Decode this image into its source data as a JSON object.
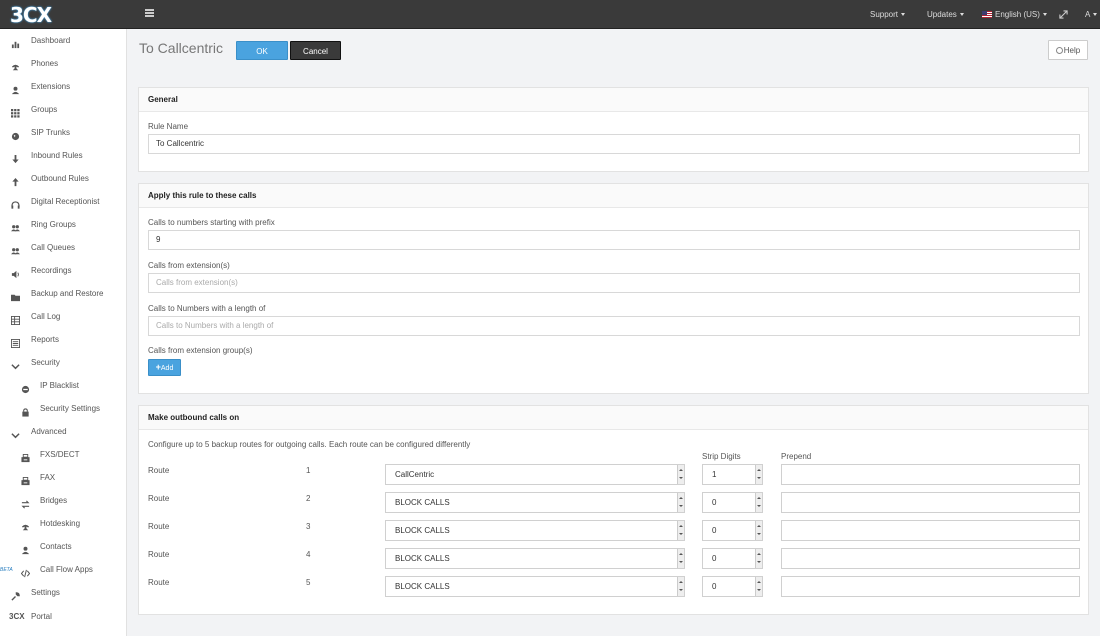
{
  "topbar": {
    "logo": "3CX",
    "support": "Support",
    "updates": "Updates",
    "language": "English (US)",
    "user": "A"
  },
  "sidebar": {
    "items": [
      {
        "label": "Dashboard",
        "icon": "bar-chart-icon"
      },
      {
        "label": "Phones",
        "icon": "phone-icon"
      },
      {
        "label": "Extensions",
        "icon": "user-icon"
      },
      {
        "label": "Groups",
        "icon": "grid-icon"
      },
      {
        "label": "SIP Trunks",
        "icon": "globe-icon"
      },
      {
        "label": "Inbound Rules",
        "icon": "arrow-down-icon"
      },
      {
        "label": "Outbound Rules",
        "icon": "arrow-up-icon"
      },
      {
        "label": "Digital Receptionist",
        "icon": "headset-icon"
      },
      {
        "label": "Ring Groups",
        "icon": "users-icon"
      },
      {
        "label": "Call Queues",
        "icon": "users-icon"
      },
      {
        "label": "Recordings",
        "icon": "speaker-icon"
      },
      {
        "label": "Backup and Restore",
        "icon": "folder-icon"
      },
      {
        "label": "Call Log",
        "icon": "table-icon"
      },
      {
        "label": "Reports",
        "icon": "list-icon"
      },
      {
        "label": "Security",
        "icon": "chevron-down-icon"
      },
      {
        "label": "IP Blacklist",
        "icon": "minus-circle-icon"
      },
      {
        "label": "Security Settings",
        "icon": "lock-icon"
      },
      {
        "label": "Advanced",
        "icon": "chevron-down-icon"
      },
      {
        "label": "FXS/DECT",
        "icon": "fax-icon"
      },
      {
        "label": "FAX",
        "icon": "fax-icon"
      },
      {
        "label": "Bridges",
        "icon": "exchange-icon"
      },
      {
        "label": "Hotdesking",
        "icon": "phone-icon"
      },
      {
        "label": "Contacts",
        "icon": "user-icon"
      },
      {
        "label": "Call Flow Apps",
        "icon": "code-icon",
        "badge": "BETA"
      },
      {
        "label": "Settings",
        "icon": "wrench-icon"
      },
      {
        "label": "Portal",
        "icon": "3cx-logo-icon",
        "icon_text": "3CX"
      }
    ]
  },
  "header": {
    "title": "To Callcentric",
    "ok": "OK",
    "cancel": "Cancel",
    "help": "Help"
  },
  "general": {
    "heading": "General",
    "rule_name_label": "Rule Name",
    "rule_name_value": "To Callcentric"
  },
  "apply": {
    "heading": "Apply this rule to these calls",
    "prefix_label": "Calls to numbers starting with prefix",
    "prefix_value": "9",
    "from_ext_label": "Calls from extension(s)",
    "from_ext_placeholder": "Calls from extension(s)",
    "length_label": "Calls to Numbers with a length of",
    "length_placeholder": "Calls to Numbers with a length of",
    "group_label": "Calls from extension group(s)",
    "add_label": "Add"
  },
  "outbound": {
    "heading": "Make outbound calls on",
    "description": "Configure up to 5 backup routes for outgoing calls. Each route can be configured differently",
    "strip_digits_header": "Strip Digits",
    "prepend_header": "Prepend",
    "routes": [
      {
        "label": "Route",
        "number": "1",
        "gateway": "CallCentric",
        "strip": "1",
        "prepend": ""
      },
      {
        "label": "Route",
        "number": "2",
        "gateway": "BLOCK CALLS",
        "strip": "0",
        "prepend": ""
      },
      {
        "label": "Route",
        "number": "3",
        "gateway": "BLOCK CALLS",
        "strip": "0",
        "prepend": ""
      },
      {
        "label": "Route",
        "number": "4",
        "gateway": "BLOCK CALLS",
        "strip": "0",
        "prepend": ""
      },
      {
        "label": "Route",
        "number": "5",
        "gateway": "BLOCK CALLS",
        "strip": "0",
        "prepend": ""
      }
    ]
  }
}
